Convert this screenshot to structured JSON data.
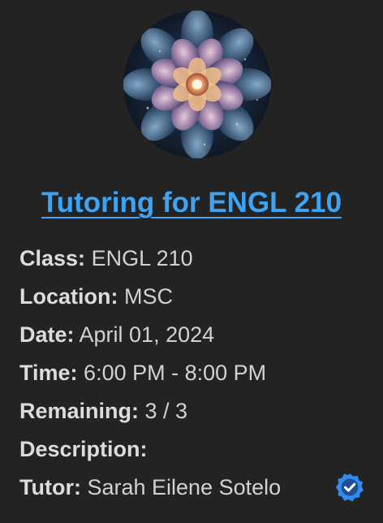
{
  "avatar": {
    "icon": "flower-fractal-image",
    "colors": {
      "petal_light": "#f3b890",
      "petal_mid": "#8a6e9a",
      "dark_blue": "#1b2d40",
      "background": "#111821"
    }
  },
  "title": "Tutoring for ENGL 210",
  "details": {
    "class": {
      "label": "Class:",
      "value": "ENGL 210"
    },
    "location": {
      "label": "Location:",
      "value": "MSC"
    },
    "date": {
      "label": "Date:",
      "value": "April 01, 2024"
    },
    "time": {
      "label": "Time:",
      "value": "6:00 PM - 8:00 PM"
    },
    "remaining": {
      "label": "Remaining:",
      "value": "3 / 3"
    },
    "description": {
      "label": "Description:",
      "value": ""
    },
    "tutor": {
      "label": "Tutor:",
      "value": "Sarah Eilene Sotelo"
    }
  },
  "verified_badge": {
    "icon": "verified-check-icon",
    "color": "#2f8cf0"
  },
  "colors": {
    "background": "#232323",
    "accent": "#3da3f5",
    "text": "#d4d4d4"
  }
}
